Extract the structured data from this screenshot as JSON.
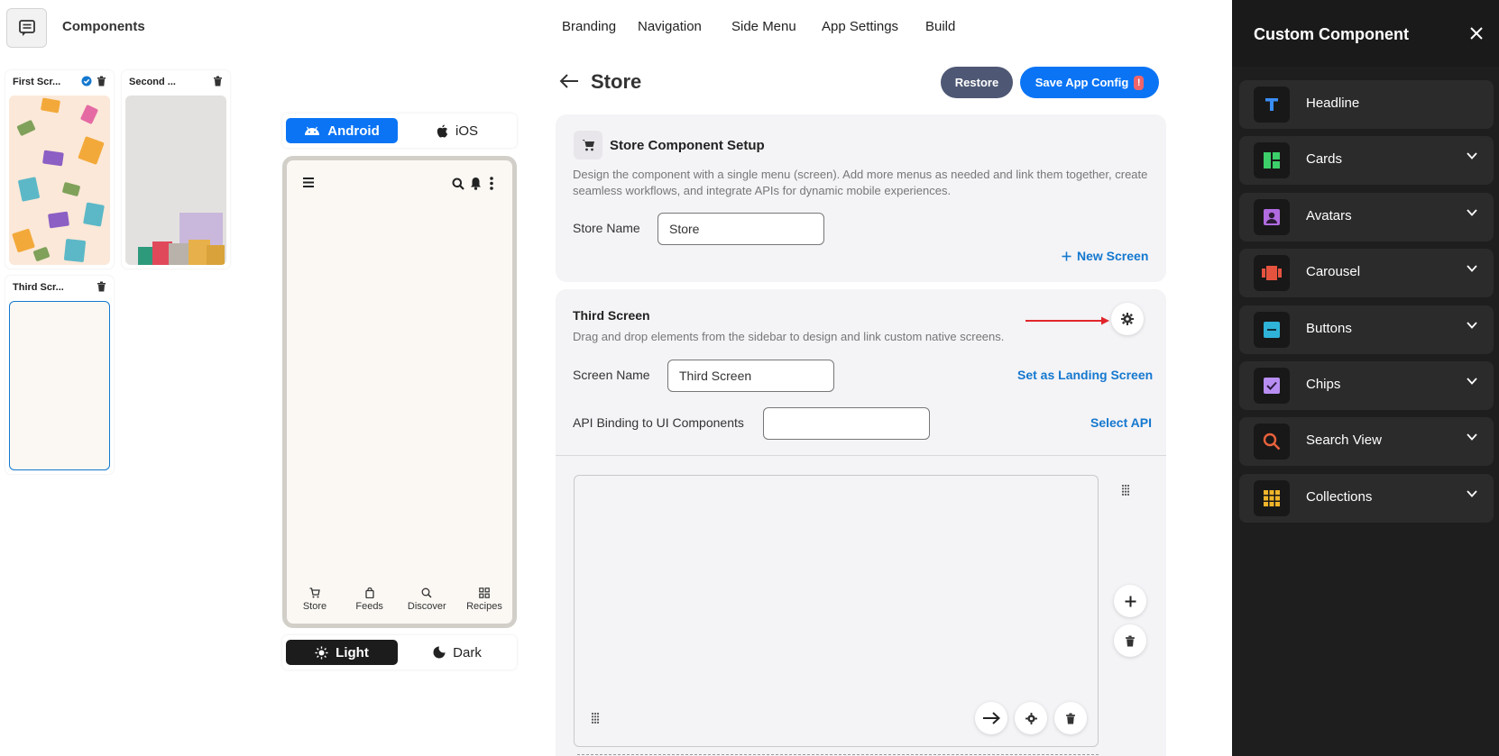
{
  "header": {
    "title": "Components",
    "nav": [
      "Branding",
      "Navigation",
      "Side Menu",
      "App Settings",
      "Build"
    ]
  },
  "thumbnails": [
    {
      "label": "First Scr...",
      "selected": true
    },
    {
      "label": "Second ...",
      "selected": false
    },
    {
      "label": "Third Scr...",
      "selected": false
    }
  ],
  "preview": {
    "platforms": [
      "Android",
      "iOS"
    ],
    "active_platform": "Android",
    "bottom_nav": [
      "Store",
      "Feeds",
      "Discover",
      "Recipes"
    ],
    "themes": [
      "Light",
      "Dark"
    ],
    "active_theme": "Light"
  },
  "page": {
    "title": "Store",
    "restore_label": "Restore",
    "save_label": "Save App Config",
    "save_badge": "!"
  },
  "setup": {
    "title": "Store Component Setup",
    "description": "Design the component with a single menu (screen). Add more menus as needed and link them together, create seamless workflows, and integrate APIs for dynamic mobile experiences.",
    "store_name_label": "Store Name",
    "store_name_value": "Store",
    "new_screen_label": "New Screen"
  },
  "screen": {
    "title": "Third Screen",
    "description": "Drag and drop elements from the sidebar to design and link custom native screens.",
    "screen_name_label": "Screen Name",
    "screen_name_value": "Third Screen",
    "landing_label": "Set as Landing Screen",
    "api_label": "API Binding to UI Components",
    "api_value": "",
    "select_api_label": "Select API"
  },
  "sidebar": {
    "title": "Custom Component",
    "items": [
      {
        "label": "Headline",
        "icon": "headline-icon",
        "color": "#3a8df5",
        "expandable": false
      },
      {
        "label": "Cards",
        "icon": "cards-icon",
        "color": "#3ccf6a",
        "expandable": true
      },
      {
        "label": "Avatars",
        "icon": "avatars-icon",
        "color": "#b06be0",
        "expandable": true
      },
      {
        "label": "Carousel",
        "icon": "carousel-icon",
        "color": "#e5533f",
        "expandable": true
      },
      {
        "label": "Buttons",
        "icon": "buttons-icon",
        "color": "#2fb3d9",
        "expandable": true
      },
      {
        "label": "Chips",
        "icon": "chips-icon",
        "color": "#b88ef2",
        "expandable": true
      },
      {
        "label": "Search View",
        "icon": "search-view-icon",
        "color": "#e8623c",
        "expandable": true
      },
      {
        "label": "Collections",
        "icon": "collections-icon",
        "color": "#f1b52a",
        "expandable": true
      }
    ]
  },
  "colors": {
    "accent": "#0a74f5",
    "restore": "#4e5874",
    "sidebar_bg": "#1e1e1e"
  }
}
